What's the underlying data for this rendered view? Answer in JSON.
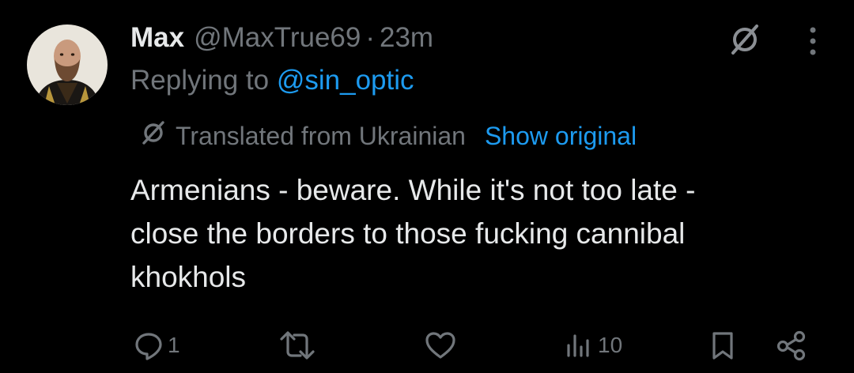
{
  "tweet": {
    "display_name": "Max",
    "handle": "@MaxTrue69",
    "separator": "·",
    "time": "23m",
    "replying_prefix": "Replying to ",
    "replying_handle": "@sin_optic",
    "translated_from": "Translated from Ukrainian",
    "show_original": "Show original",
    "text_lines": [
      "Armenians - beware. While it's not too late -",
      "close the borders to those fucking cannibal",
      "khokhols"
    ]
  },
  "actions": {
    "reply_count": "1",
    "repost_count": "",
    "like_count": "",
    "views_count": "10"
  },
  "icons": {
    "translate": "translate-icon",
    "more": "more-dots-icon",
    "reply": "reply-icon",
    "repost": "repost-icon",
    "like": "heart-icon",
    "views": "views-icon",
    "bookmark": "bookmark-icon",
    "share": "share-icon"
  },
  "colors": {
    "background": "#000000",
    "text": "#e7e9ea",
    "muted": "#71767b",
    "link": "#1d9bf0"
  }
}
